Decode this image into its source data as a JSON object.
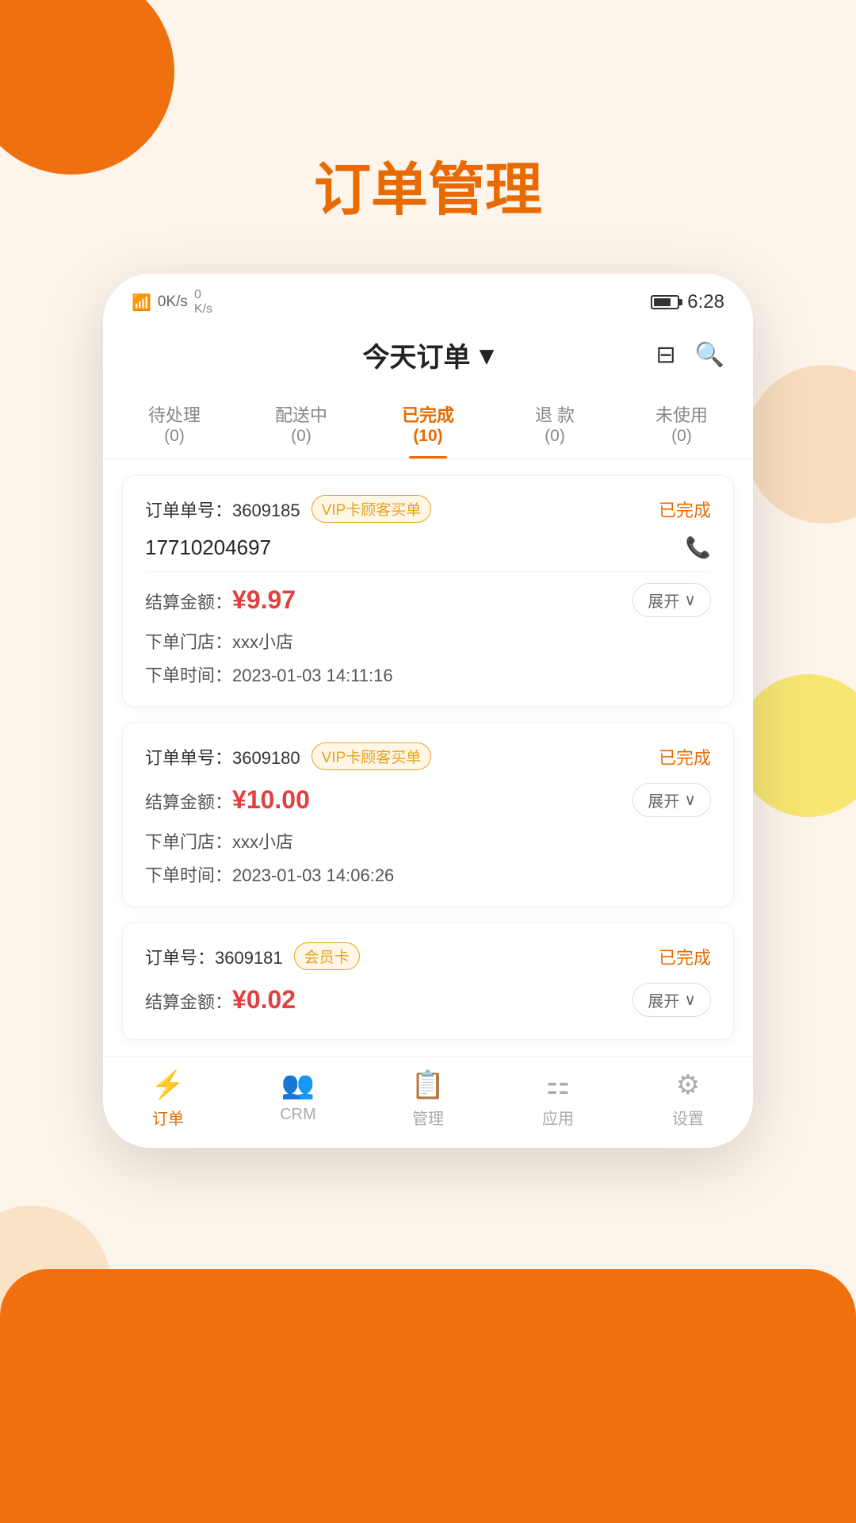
{
  "page": {
    "title": "订单管理",
    "background_color": "#fdf4eb"
  },
  "status_bar": {
    "time": "6:28",
    "signal_icons": "📶"
  },
  "header": {
    "title": "今天订单",
    "dropdown_icon": "▾",
    "filter_label": "filter-icon",
    "search_label": "search-icon"
  },
  "tabs": [
    {
      "label": "待处理",
      "count": "(0)",
      "active": false
    },
    {
      "label": "配送中",
      "count": "(0)",
      "active": false
    },
    {
      "label": "已完成",
      "count": "(10)",
      "active": true
    },
    {
      "label": "退 款",
      "count": "(0)",
      "active": false
    },
    {
      "label": "未使用",
      "count": "(0)",
      "active": false
    }
  ],
  "orders": [
    {
      "id": "order-1",
      "number_label": "订单单号：",
      "number": "3609185",
      "badge_type": "vip",
      "badge_text": "VIP卡顾客买单",
      "status": "已完成",
      "phone": "17710204697",
      "amount_label": "结算金额：",
      "amount": "¥9.97",
      "expand_label": "展开",
      "store_label": "下单门店：",
      "store": "xxx小店",
      "time_label": "下单时间：",
      "time": "2023-01-03 14:11:16"
    },
    {
      "id": "order-2",
      "number_label": "订单单号：",
      "number": "3609180",
      "badge_type": "vip",
      "badge_text": "VIP卡顾客买单",
      "status": "已完成",
      "phone": null,
      "amount_label": "结算金额：",
      "amount": "¥10.00",
      "expand_label": "展开",
      "store_label": "下单门店：",
      "store": "xxx小店",
      "time_label": "下单时间：",
      "time": "2023-01-03 14:06:26"
    },
    {
      "id": "order-3",
      "number_label": "订单号：",
      "number": "3609181",
      "badge_type": "member",
      "badge_text": "会员卡",
      "status": "已完成",
      "phone": null,
      "amount_label": "结算金额：",
      "amount": "¥0.02",
      "expand_label": "展开",
      "store_label": null,
      "store": null,
      "time_label": null,
      "time": null
    }
  ],
  "bottom_nav": [
    {
      "id": "nav-orders",
      "icon": "⚡",
      "label": "订单",
      "active": true
    },
    {
      "id": "nav-crm",
      "icon": "👥",
      "label": "CRM",
      "active": false
    },
    {
      "id": "nav-manage",
      "icon": "📋",
      "label": "管理",
      "active": false
    },
    {
      "id": "nav-apps",
      "icon": "🔲",
      "label": "应用",
      "active": false
    },
    {
      "id": "nav-settings",
      "icon": "⚙",
      "label": "设置",
      "active": false
    }
  ]
}
